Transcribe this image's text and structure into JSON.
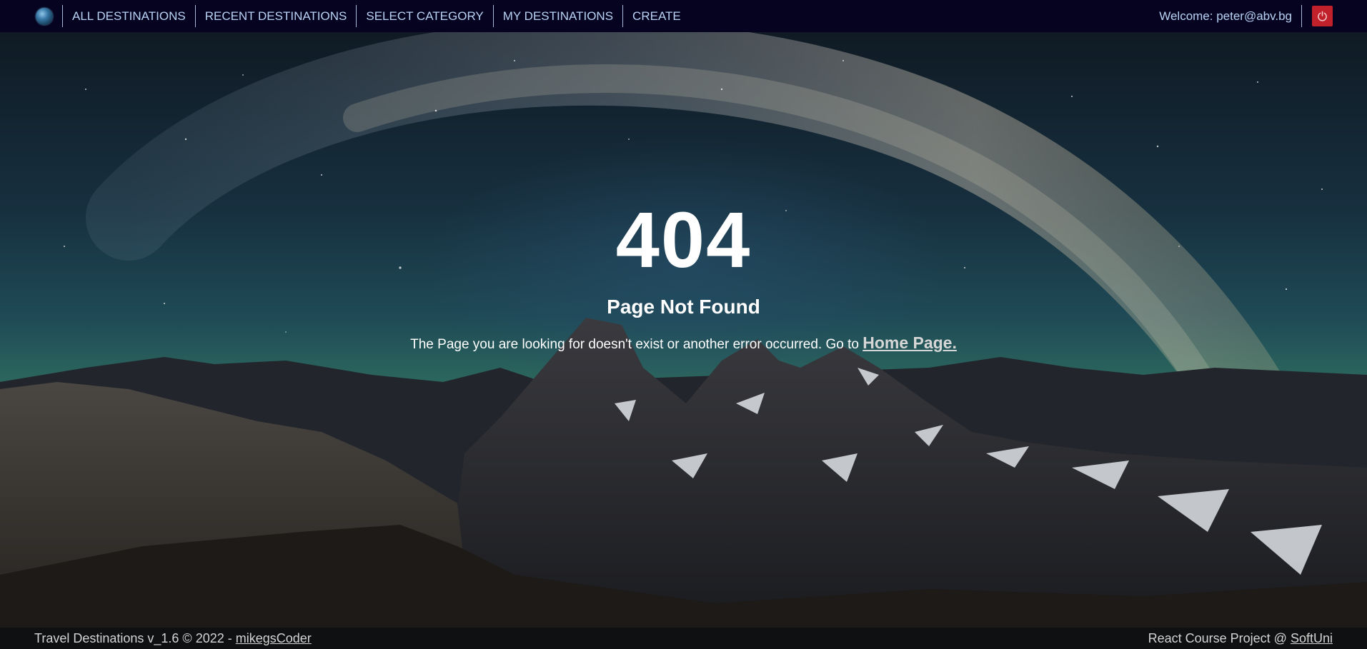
{
  "nav": {
    "logo_icon": "globe-icon",
    "links": [
      {
        "label": "ALL DESTINATIONS"
      },
      {
        "label": "RECENT DESTINATIONS"
      },
      {
        "label": "SELECT CATEGORY"
      },
      {
        "label": "MY DESTINATIONS"
      },
      {
        "label": "CREATE"
      }
    ],
    "welcome": "Welcome: peter@abv.bg",
    "logout_icon": "power-icon"
  },
  "error": {
    "code": "404",
    "title": "Page Not Found",
    "message": "The Page you are looking for doesn't exist or another error occurred. Go to ",
    "home_link": "Home Page."
  },
  "footer": {
    "left_text": "Travel Destinations v_1.6 © 2022 - ",
    "left_link": "mikegsCoder",
    "right_text": "React Course Project @ ",
    "right_link": "SoftUni"
  },
  "colors": {
    "navbar_bg": "#050320",
    "nav_link": "#b9d3f5",
    "logout_bg": "#c0212b",
    "footer_bg": "#0f1011"
  }
}
